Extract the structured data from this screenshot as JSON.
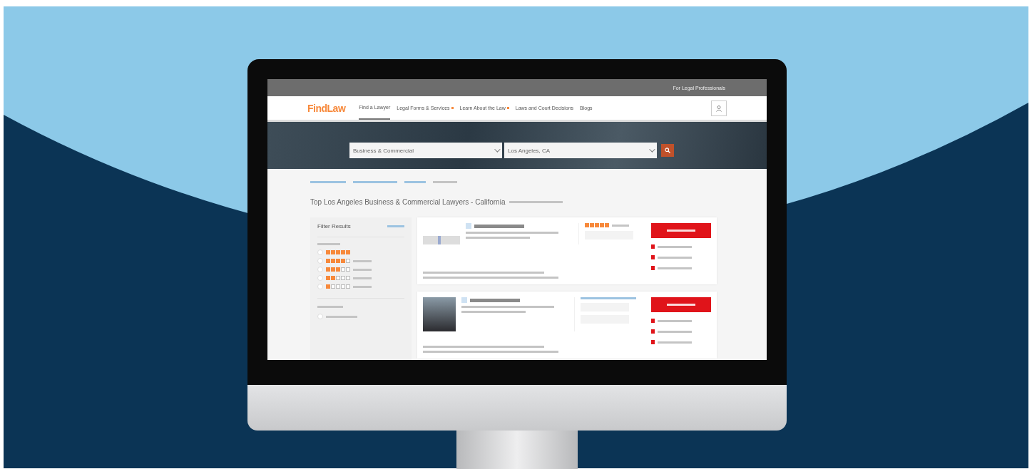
{
  "topbar": {
    "link": "For Legal Professionals"
  },
  "nav": {
    "logo": "FindLaw",
    "items": [
      {
        "label": "Find a Lawyer",
        "selected": true,
        "has_menu": false
      },
      {
        "label": "Legal Forms & Services",
        "selected": false,
        "has_menu": true
      },
      {
        "label": "Learn About the Law",
        "selected": false,
        "has_menu": true
      },
      {
        "label": "Laws and Court Decisions",
        "selected": false,
        "has_menu": false
      },
      {
        "label": "Blogs",
        "selected": false,
        "has_menu": false
      }
    ]
  },
  "search": {
    "issue_value": "Business & Commercial",
    "location_value": "Los Angeles, CA"
  },
  "title": "Top Los Angeles Business & Commercial Lawyers - California",
  "filters": {
    "heading": "Filter Results",
    "ratings": [
      {
        "stars": 5,
        "checked": false
      },
      {
        "stars": 4,
        "checked": false
      },
      {
        "stars": 3,
        "checked": false
      },
      {
        "stars": 2,
        "checked": false
      },
      {
        "stars": 1,
        "checked": false
      }
    ],
    "options": [
      {
        "checked": false
      }
    ]
  },
  "listings": [
    {
      "kind": "logo",
      "stars": 5
    },
    {
      "kind": "photo"
    }
  ]
}
